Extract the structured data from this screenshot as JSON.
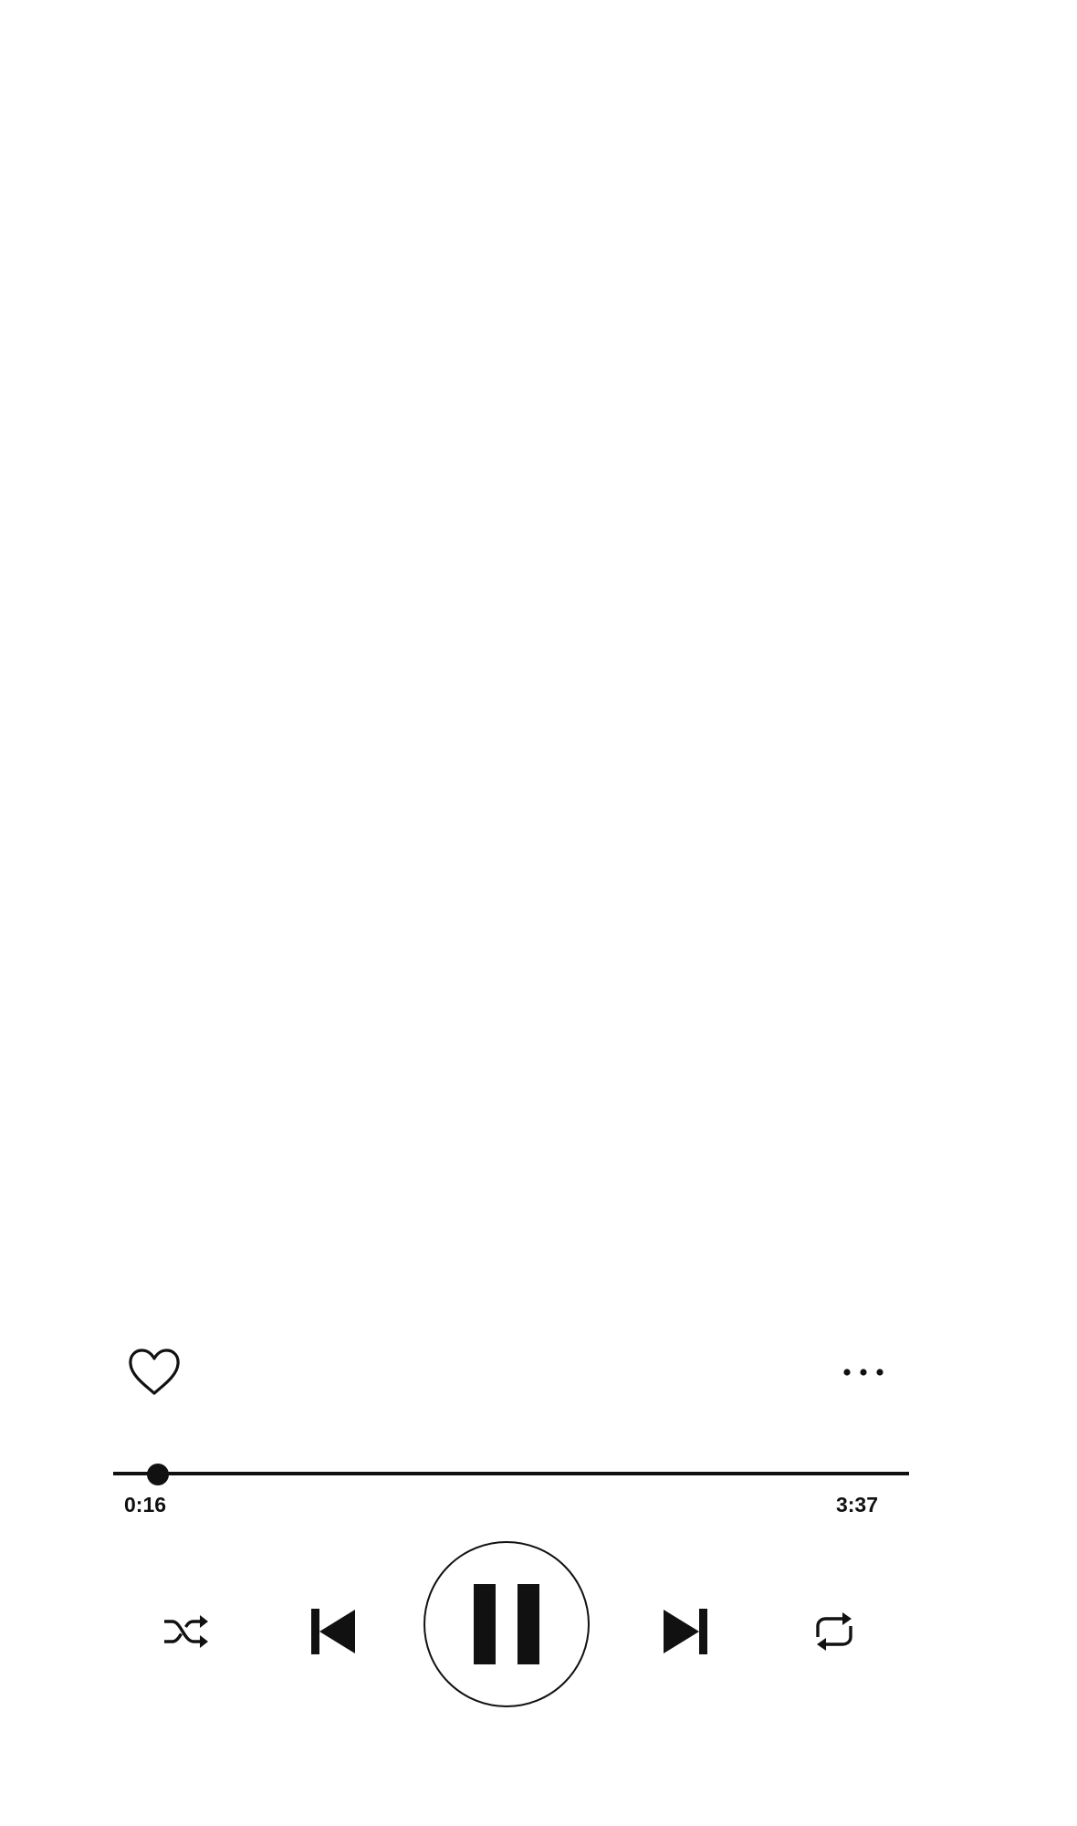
{
  "player": {
    "elapsed_time": "0:16",
    "total_time": "3:37",
    "progress_fraction": 0.056,
    "is_playing": true,
    "liked": false,
    "accent_color": "#111111",
    "background_color": "#ffffff"
  },
  "icons": {
    "like": "heart-outline-icon",
    "more": "more-dots-icon",
    "shuffle": "shuffle-icon",
    "previous": "skip-previous-icon",
    "play_pause": "pause-icon",
    "next": "skip-next-icon",
    "repeat": "repeat-icon"
  }
}
